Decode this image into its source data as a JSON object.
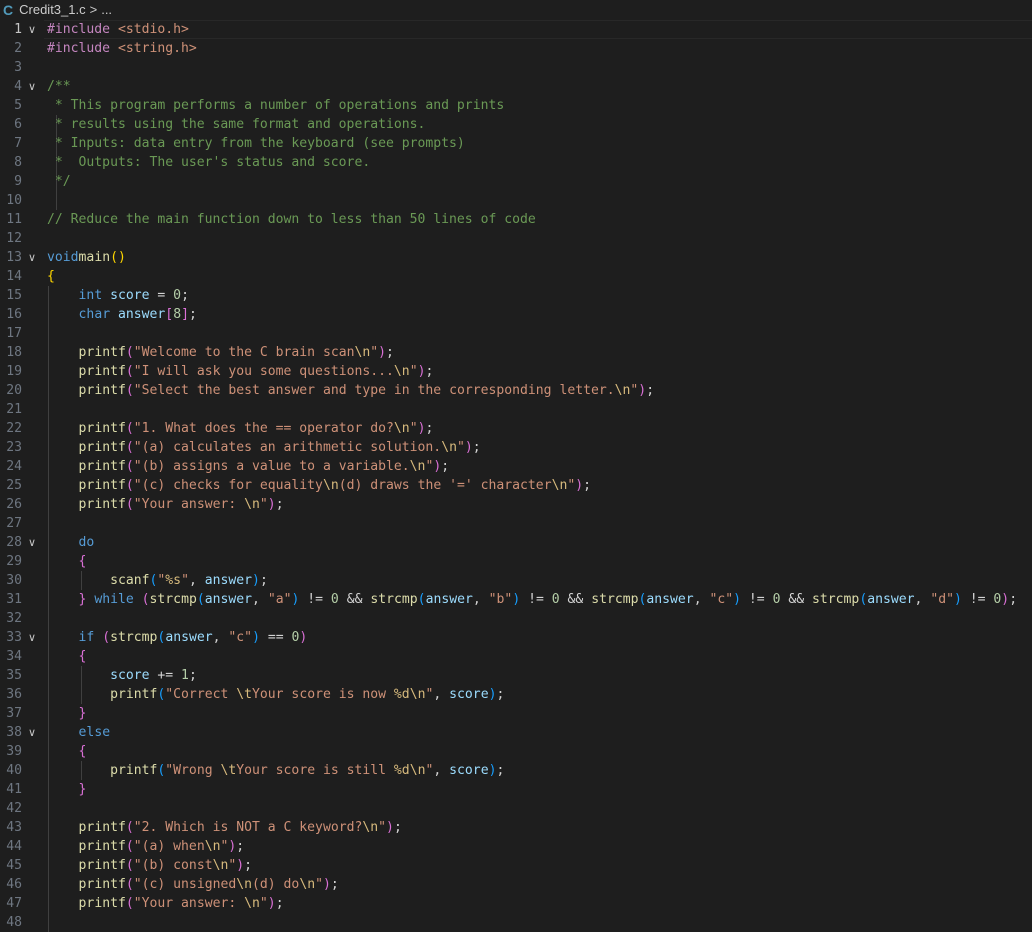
{
  "breadcrumb": {
    "language_icon": "C",
    "file_name": "Credit3_1.c",
    "separator": ">",
    "trailing": "..."
  },
  "editor": {
    "active_line": 1,
    "lines": [
      {
        "n": "1",
        "fold": true,
        "tokens": [
          [
            "pre",
            "#include "
          ],
          [
            "inc",
            "<stdio.h>"
          ]
        ]
      },
      {
        "n": "2",
        "tokens": [
          [
            "pre",
            "#include "
          ],
          [
            "inc",
            "<string.h>"
          ]
        ]
      },
      {
        "n": "3",
        "tokens": []
      },
      {
        "n": "4",
        "fold": true,
        "tokens": [
          [
            "cmt",
            "/**"
          ]
        ]
      },
      {
        "n": "5",
        "tokens": [
          [
            "cmt",
            " * This program performs a number of operations and prints"
          ]
        ]
      },
      {
        "n": "6",
        "tokens": [
          [
            "cmt",
            " * results using the same format and operations."
          ]
        ]
      },
      {
        "n": "7",
        "tokens": [
          [
            "cmt",
            " * Inputs: data entry from the keyboard (see prompts)"
          ]
        ]
      },
      {
        "n": "8",
        "tokens": [
          [
            "cmt",
            " *  Outputs: The user's status and score."
          ]
        ]
      },
      {
        "n": "9",
        "tokens": [
          [
            "cmt",
            " */"
          ]
        ]
      },
      {
        "n": "10",
        "tokens": []
      },
      {
        "n": "11",
        "tokens": [
          [
            "cmt",
            "// Reduce the main function down to less than 50 lines of code"
          ]
        ]
      },
      {
        "n": "12",
        "tokens": []
      },
      {
        "n": "13",
        "fold": true,
        "tokens": [
          [
            "kw",
            "void"
          ],
          [
            "",
            "main"
          ],
          [
            "b1",
            "()"
          ]
        ]
      },
      {
        "n": "14",
        "tokens": [
          [
            "b1",
            "{"
          ]
        ]
      },
      {
        "n": "15",
        "tokens": [
          [
            "",
            "    "
          ],
          [
            "kw",
            "int"
          ],
          [
            "",
            " score = "
          ],
          [
            "num",
            "0"
          ],
          [
            "",
            ";"
          ]
        ]
      },
      {
        "n": "16",
        "tokens": [
          [
            "",
            "    "
          ],
          [
            "kw",
            "char"
          ],
          [
            "",
            " answer"
          ],
          [
            "b2",
            "["
          ],
          [
            "num",
            "8"
          ],
          [
            "b2",
            "]"
          ],
          [
            "",
            ";"
          ]
        ]
      },
      {
        "n": "17",
        "tokens": []
      },
      {
        "n": "18",
        "tokens": [
          [
            "",
            "    printf"
          ],
          [
            "b2",
            "("
          ],
          [
            "str",
            "\"Welcome to the C brain scan\\n\""
          ],
          [
            "b2",
            ")"
          ],
          [
            "",
            ";"
          ]
        ]
      },
      {
        "n": "19",
        "tokens": [
          [
            "",
            "    printf"
          ],
          [
            "b2",
            "("
          ],
          [
            "str",
            "\"I will ask you some questions...\\n\""
          ],
          [
            "b2",
            ")"
          ],
          [
            "",
            ";"
          ]
        ]
      },
      {
        "n": "20",
        "tokens": [
          [
            "",
            "    printf"
          ],
          [
            "b2",
            "("
          ],
          [
            "str",
            "\"Select the best answer and type in the corresponding letter.\\n\""
          ],
          [
            "b2",
            ")"
          ],
          [
            "",
            ";"
          ]
        ]
      },
      {
        "n": "21",
        "tokens": []
      },
      {
        "n": "22",
        "tokens": [
          [
            "",
            "    printf"
          ],
          [
            "b2",
            "("
          ],
          [
            "str",
            "\"1. What does the == operator do?\\n\""
          ],
          [
            "b2",
            ")"
          ],
          [
            "",
            ";"
          ]
        ]
      },
      {
        "n": "23",
        "tokens": [
          [
            "",
            "    printf"
          ],
          [
            "b2",
            "("
          ],
          [
            "str",
            "\"(a) calculates an arithmetic solution.\\n\""
          ],
          [
            "b2",
            ")"
          ],
          [
            "",
            ";"
          ]
        ]
      },
      {
        "n": "24",
        "tokens": [
          [
            "",
            "    printf"
          ],
          [
            "b2",
            "("
          ],
          [
            "str",
            "\"(b) assigns a value to a variable.\\n\""
          ],
          [
            "b2",
            ")"
          ],
          [
            "",
            ";"
          ]
        ]
      },
      {
        "n": "25",
        "tokens": [
          [
            "",
            "    printf"
          ],
          [
            "b2",
            "("
          ],
          [
            "str",
            "\"(c) checks for equality\\n(d) draws the '=' character\\n\""
          ],
          [
            "b2",
            ")"
          ],
          [
            "",
            ";"
          ]
        ]
      },
      {
        "n": "26",
        "tokens": [
          [
            "",
            "    printf"
          ],
          [
            "b2",
            "("
          ],
          [
            "str",
            "\"Your answer: \\n\""
          ],
          [
            "b2",
            ")"
          ],
          [
            "",
            ";"
          ]
        ]
      },
      {
        "n": "27",
        "tokens": []
      },
      {
        "n": "28",
        "fold": true,
        "tokens": [
          [
            "",
            "    "
          ],
          [
            "kw",
            "do"
          ]
        ]
      },
      {
        "n": "29",
        "tokens": [
          [
            "",
            "    "
          ],
          [
            "b2",
            "{"
          ]
        ]
      },
      {
        "n": "30",
        "tokens": [
          [
            "",
            "        scanf"
          ],
          [
            "b3",
            "("
          ],
          [
            "str",
            "\"%s\""
          ],
          [
            "",
            ", answer"
          ],
          [
            "b3",
            ")"
          ],
          [
            "",
            ";"
          ]
        ]
      },
      {
        "n": "31",
        "tokens": [
          [
            "",
            "    "
          ],
          [
            "b2",
            "}"
          ],
          [
            "",
            " "
          ],
          [
            "kw",
            "while"
          ],
          [
            "",
            " "
          ],
          [
            "b2",
            "("
          ],
          [
            "",
            "strcmp"
          ],
          [
            "b3",
            "("
          ],
          [
            "",
            "answer, "
          ],
          [
            "str",
            "\"a\""
          ],
          [
            "b3",
            ")"
          ],
          [
            "",
            " != "
          ],
          [
            "num",
            "0"
          ],
          [
            "",
            " && strcmp"
          ],
          [
            "b3",
            "("
          ],
          [
            "",
            "answer, "
          ],
          [
            "str",
            "\"b\""
          ],
          [
            "b3",
            ")"
          ],
          [
            "",
            " != "
          ],
          [
            "num",
            "0"
          ],
          [
            "",
            " && strcmp"
          ],
          [
            "b3",
            "("
          ],
          [
            "",
            "answer, "
          ],
          [
            "str",
            "\"c\""
          ],
          [
            "b3",
            ")"
          ],
          [
            "",
            " != "
          ],
          [
            "num",
            "0"
          ],
          [
            "",
            " && strcmp"
          ],
          [
            "b3",
            "("
          ],
          [
            "",
            "answer, "
          ],
          [
            "str",
            "\"d\""
          ],
          [
            "b3",
            ")"
          ],
          [
            "",
            " != "
          ],
          [
            "num",
            "0"
          ],
          [
            "b2",
            ")"
          ],
          [
            "",
            ";"
          ]
        ]
      },
      {
        "n": "32",
        "tokens": []
      },
      {
        "n": "33",
        "fold": true,
        "tokens": [
          [
            "",
            "    "
          ],
          [
            "kw",
            "if"
          ],
          [
            "",
            " "
          ],
          [
            "b2",
            "("
          ],
          [
            "",
            "strcmp"
          ],
          [
            "b3",
            "("
          ],
          [
            "",
            "answer, "
          ],
          [
            "str",
            "\"c\""
          ],
          [
            "b3",
            ")"
          ],
          [
            "",
            " == "
          ],
          [
            "num",
            "0"
          ],
          [
            "b2",
            ")"
          ]
        ]
      },
      {
        "n": "34",
        "tokens": [
          [
            "",
            "    "
          ],
          [
            "b2",
            "{"
          ]
        ]
      },
      {
        "n": "35",
        "tokens": [
          [
            "",
            "        score += "
          ],
          [
            "num",
            "1"
          ],
          [
            "",
            ";"
          ]
        ]
      },
      {
        "n": "36",
        "tokens": [
          [
            "",
            "        printf"
          ],
          [
            "b3",
            "("
          ],
          [
            "str",
            "\"Correct \\tYour score is now %d\\n\""
          ],
          [
            "",
            ", score"
          ],
          [
            "b3",
            ")"
          ],
          [
            "",
            ";"
          ]
        ]
      },
      {
        "n": "37",
        "tokens": [
          [
            "",
            "    "
          ],
          [
            "b2",
            "}"
          ]
        ]
      },
      {
        "n": "38",
        "fold": true,
        "tokens": [
          [
            "",
            "    "
          ],
          [
            "kw",
            "else"
          ]
        ]
      },
      {
        "n": "39",
        "tokens": [
          [
            "",
            "    "
          ],
          [
            "b2",
            "{"
          ]
        ]
      },
      {
        "n": "40",
        "tokens": [
          [
            "",
            "        printf"
          ],
          [
            "b3",
            "("
          ],
          [
            "str",
            "\"Wrong \\tYour score is still %d\\n\""
          ],
          [
            "",
            ", score"
          ],
          [
            "b3",
            ")"
          ],
          [
            "",
            ";"
          ]
        ]
      },
      {
        "n": "41",
        "tokens": [
          [
            "",
            "    "
          ],
          [
            "b2",
            "}"
          ]
        ]
      },
      {
        "n": "42",
        "tokens": []
      },
      {
        "n": "43",
        "tokens": [
          [
            "",
            "    printf"
          ],
          [
            "b2",
            "("
          ],
          [
            "str",
            "\"2. Which is NOT a C keyword?\\n\""
          ],
          [
            "b2",
            ")"
          ],
          [
            "",
            ";"
          ]
        ]
      },
      {
        "n": "44",
        "tokens": [
          [
            "",
            "    printf"
          ],
          [
            "b2",
            "("
          ],
          [
            "str",
            "\"(a) when\\n\""
          ],
          [
            "b2",
            ")"
          ],
          [
            "",
            ";"
          ]
        ]
      },
      {
        "n": "45",
        "tokens": [
          [
            "",
            "    printf"
          ],
          [
            "b2",
            "("
          ],
          [
            "str",
            "\"(b) const\\n\""
          ],
          [
            "b2",
            ")"
          ],
          [
            "",
            ";"
          ]
        ]
      },
      {
        "n": "46",
        "tokens": [
          [
            "",
            "    printf"
          ],
          [
            "b2",
            "("
          ],
          [
            "str",
            "\"(c) unsigned\\n(d) do\\n\""
          ],
          [
            "b2",
            ")"
          ],
          [
            "",
            ";"
          ]
        ]
      },
      {
        "n": "47",
        "tokens": [
          [
            "",
            "    printf"
          ],
          [
            "b2",
            "("
          ],
          [
            "str",
            "\"Your answer: \\n\""
          ],
          [
            "b2",
            ")"
          ],
          [
            "",
            ";"
          ]
        ]
      },
      {
        "n": "48",
        "tokens": []
      }
    ]
  },
  "colors": {
    "background": "#1e1e1e",
    "keyword": "#569cd6",
    "string": "#ce9178",
    "comment": "#6a9955",
    "number": "#b5cea8",
    "line_number": "#6e7681"
  }
}
